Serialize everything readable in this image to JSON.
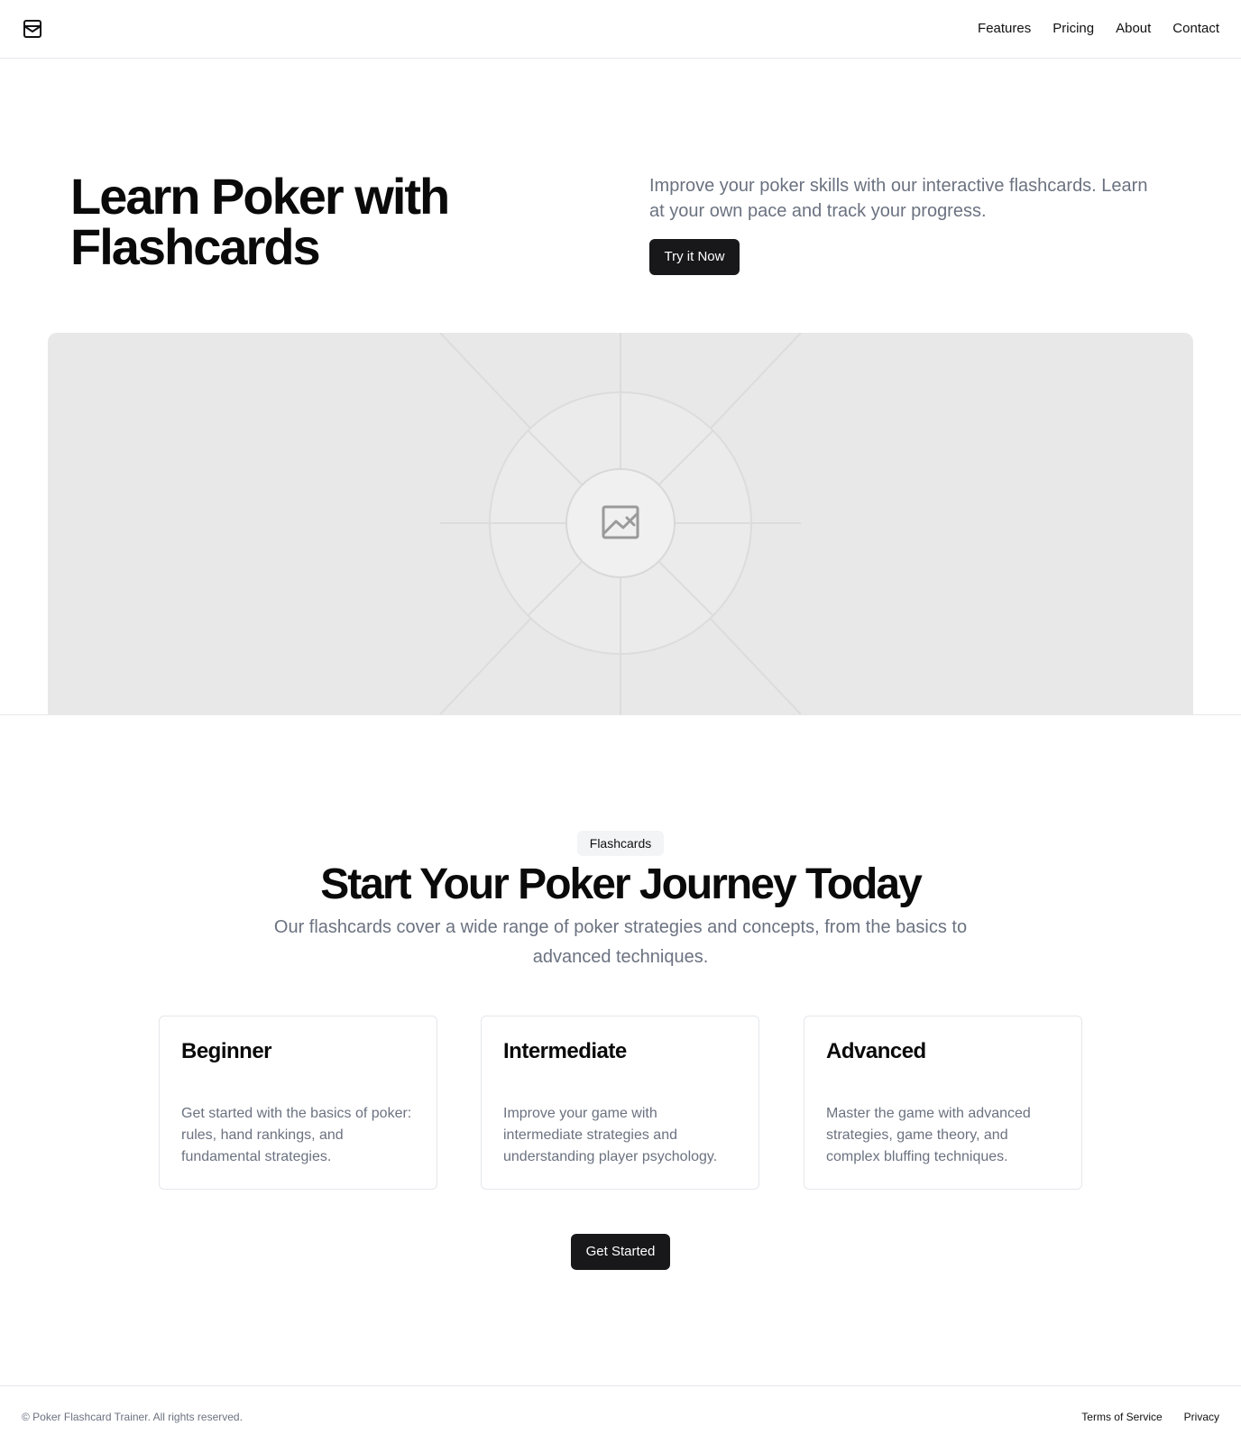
{
  "header": {
    "logo_icon": "mail-box-icon",
    "nav": [
      "Features",
      "Pricing",
      "About",
      "Contact"
    ]
  },
  "hero": {
    "title": "Learn Poker with Flashcards",
    "subtitle": "Improve your poker skills with our interactive flashcards. Learn at your own pace and track your progress.",
    "button": "Try it Now",
    "image_icon": "image-placeholder-icon"
  },
  "features": {
    "badge": "Flashcards",
    "title": "Start Your Poker Journey Today",
    "subtitle": "Our flashcards cover a wide range of poker strategies and concepts, from the basics to advanced techniques.",
    "cards": [
      {
        "title": "Beginner",
        "text": "Get started with the basics of poker: rules, hand rankings, and fundamental strategies."
      },
      {
        "title": "Intermediate",
        "text": "Improve your game with intermediate strategies and understanding player psychology."
      },
      {
        "title": "Advanced",
        "text": "Master the game with advanced strategies, game theory, and complex bluffing techniques."
      }
    ],
    "button": "Get Started"
  },
  "footer": {
    "copyright": "© Poker Flashcard Trainer. All rights reserved.",
    "links": [
      "Terms of Service",
      "Privacy"
    ]
  },
  "colors": {
    "primary_button": "#18181b",
    "muted_text": "#6b7280",
    "placeholder_bg": "#e8e8e8"
  }
}
